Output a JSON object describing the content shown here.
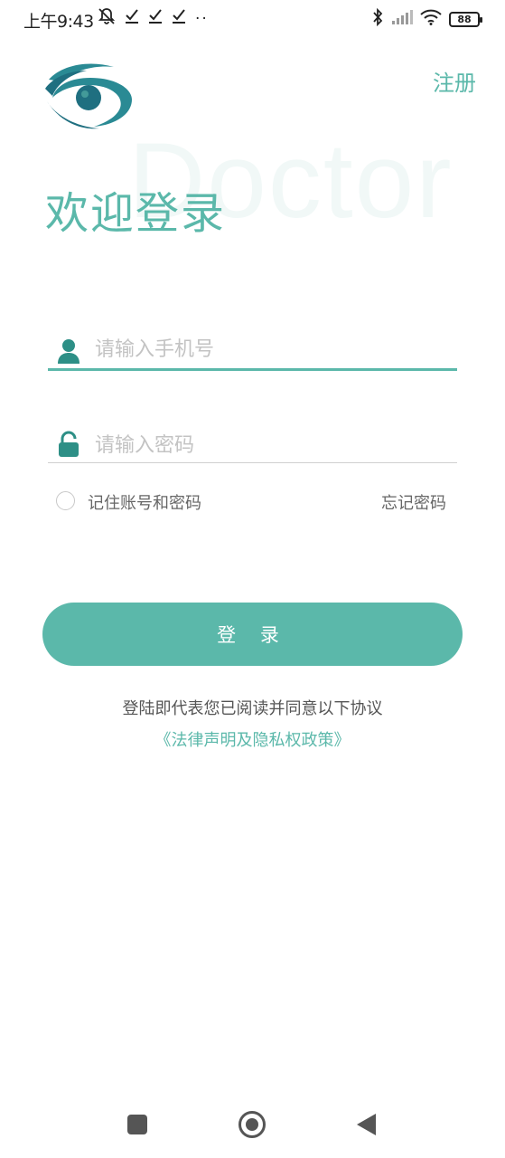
{
  "status_bar": {
    "time": "上午9:43",
    "left_icons": [
      "mute-bell-icon",
      "check-icon",
      "check-icon",
      "check-icon"
    ],
    "dots": "··",
    "battery": "88"
  },
  "header": {
    "register_label": "注册",
    "watermark": "Doctor",
    "welcome_title": "欢迎登录"
  },
  "form": {
    "phone_placeholder": "请输入手机号",
    "password_placeholder": "请输入密码",
    "remember_label": "记住账号和密码",
    "forgot_label": "忘记密码",
    "login_label": "登 录"
  },
  "agreement": {
    "text": "登陆即代表您已阅读并同意以下协议",
    "policy_link": "《法律声明及隐私权政策》"
  },
  "colors": {
    "accent": "#5bb8aa",
    "logo_dark": "#1f6f80",
    "icon_teal": "#2d8f86"
  }
}
